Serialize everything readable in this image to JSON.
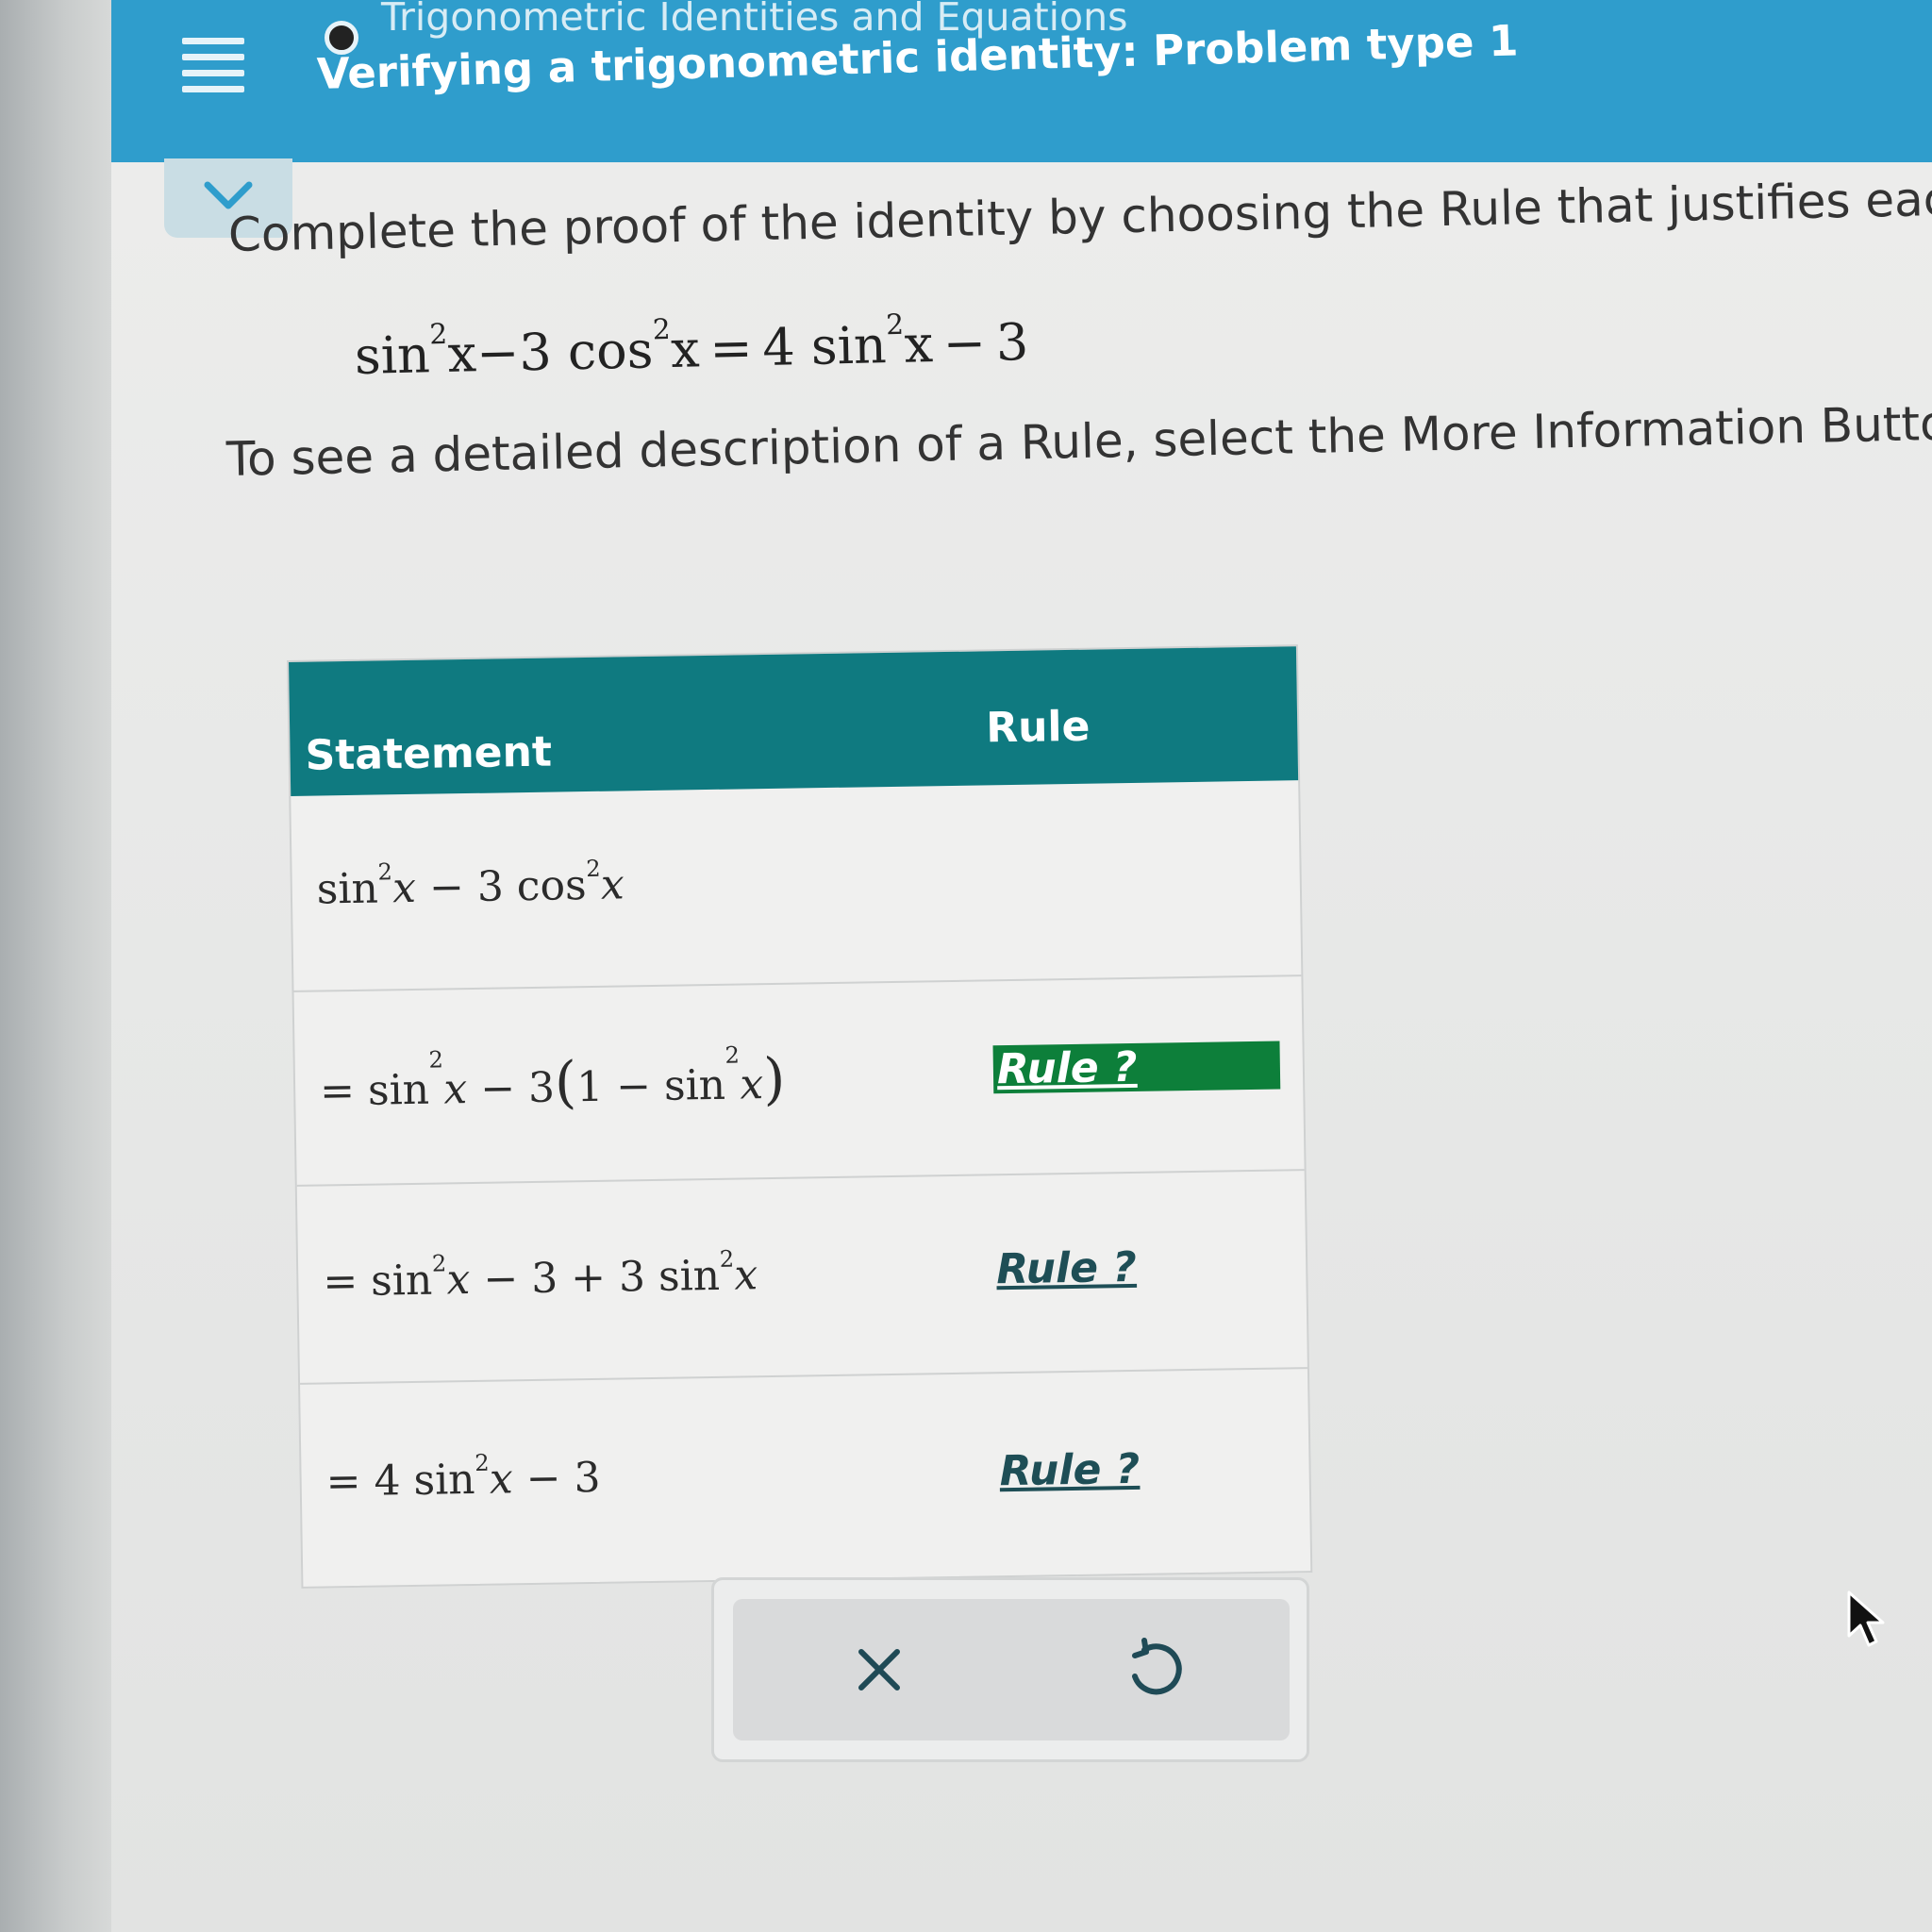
{
  "header": {
    "topic": "Trigonometric Identities and Equations",
    "title": "Verifying a trigonometric identity: Problem type 1"
  },
  "instruction": "Complete the proof of the identity by choosing the Rule that justifies each s",
  "identity": {
    "pre": "sin",
    "a": "x−3 cos",
    "b": "x = 4 sin",
    "c": "x − 3",
    "exp": "2"
  },
  "hint": "To see a detailed description of a Rule, select the More Information Button",
  "table": {
    "headers": {
      "statement": "Statement",
      "rule": "Rule"
    },
    "rows": [
      {
        "statement": "sin²x − 3 cos²x",
        "rule": ""
      },
      {
        "statement": "= sin²x − 3(1 − sin²x)",
        "rule": "Rule ?"
      },
      {
        "statement": "= sin²x − 3 + 3 sin²x",
        "rule": "Rule ?"
      },
      {
        "statement": "= 4 sin²x − 3",
        "rule": "Rule ?"
      }
    ]
  },
  "actions": {
    "clear_icon": "close-icon",
    "undo_icon": "undo-icon"
  },
  "colors": {
    "header": "#2f9dcc",
    "table_header": "#0f7a80",
    "rule_active": "#0d7f3a"
  }
}
